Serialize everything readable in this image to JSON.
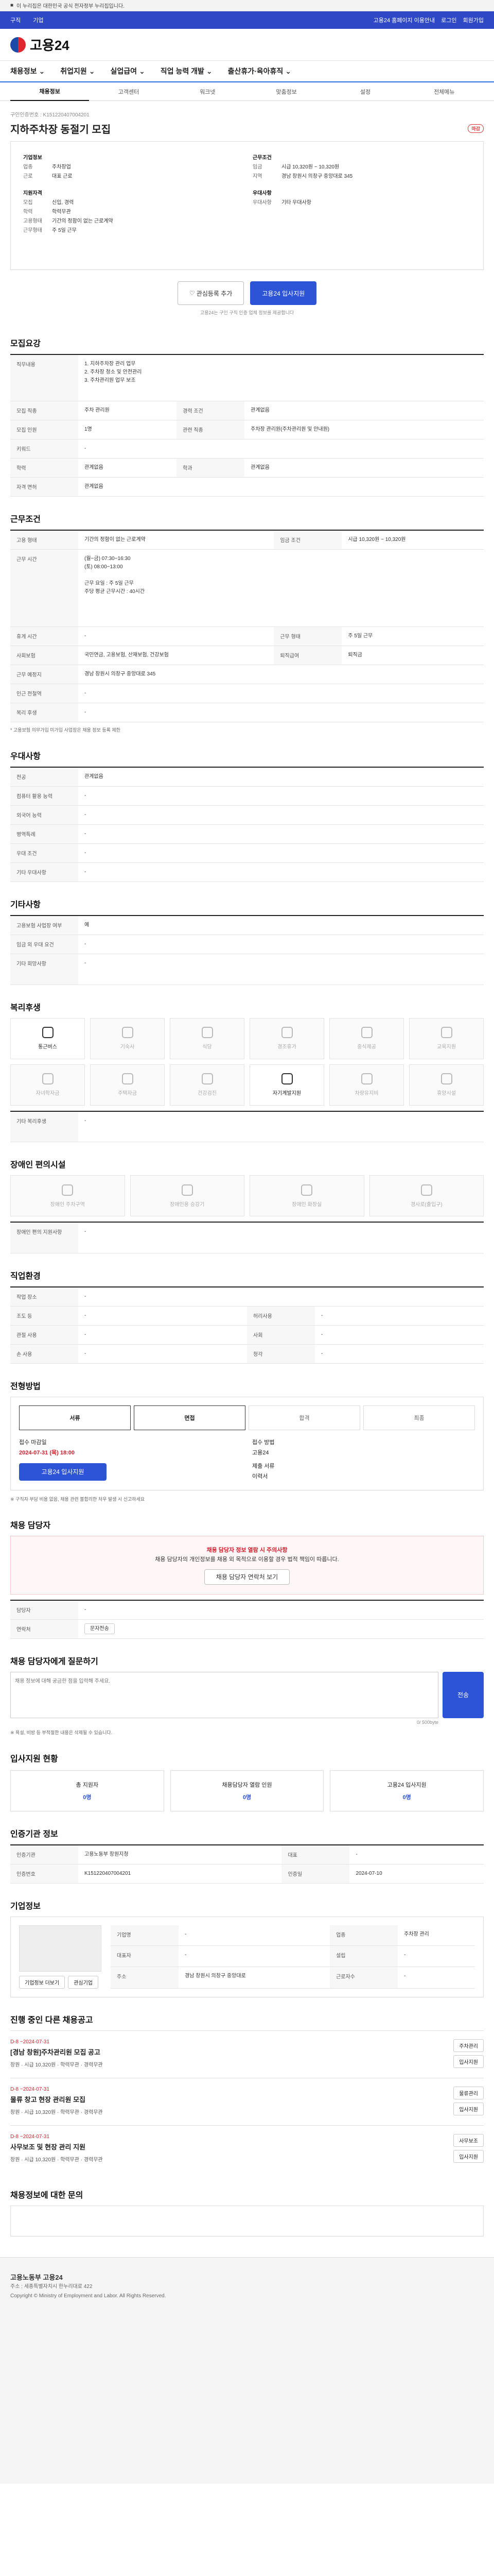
{
  "gov_banner": "이 누리집은 대한민국 공식 전자정부 누리집입니다.",
  "gnb": {
    "left": [
      "구직",
      "기업"
    ],
    "right": [
      "고용24 홈페이지 이용안내",
      "로그인",
      "회원가입"
    ]
  },
  "logo": "고용24",
  "menu": [
    "채용정보",
    "취업지원",
    "실업급여",
    "직업 능력 개발",
    "출산휴가·육아휴직"
  ],
  "tabs": [
    "채용정보",
    "고객센터",
    "워크넷",
    "맞춤정보",
    "설정",
    "전체메뉴"
  ],
  "job": {
    "number": "구인인증번호 : K151220407004201",
    "title": "지하주차장 동절기 모집",
    "status": "마감"
  },
  "summary": {
    "left": {
      "h1": "기업정보",
      "rows": [
        [
          "업종",
          "주차장업"
        ],
        [
          "근로",
          "대표 근로"
        ]
      ],
      "h2": "지원자격",
      "rows2": [
        [
          "모집",
          "신입, 경력"
        ],
        [
          "학력",
          "학력무관"
        ],
        [
          "고용형태",
          "기간의 정함이 없는 근로계약"
        ],
        [
          "근무형태",
          "주 5일 근무"
        ]
      ]
    },
    "right": {
      "h1": "근무조건",
      "rows": [
        [
          "임금",
          "시급 10,320원 ~ 10,320원"
        ],
        [
          "지역",
          "경남 창원시 의창구 중앙대로 345"
        ]
      ],
      "h2": "우대사항",
      "rows2": [
        [
          "우대사항",
          "기타 우대사항"
        ]
      ]
    }
  },
  "actions": {
    "save": "관심등록 추가",
    "apply": "고용24 입사지원",
    "notice": "고용24는 구인 구직 인증 업체 정보를 제공합니다"
  },
  "s1": {
    "title": "모집요강",
    "rows": [
      [
        "직무내용",
        "1. 지하주차장 관리 업무\n2. 주차장 청소 및 안전관리\n3. 주차관리원 업무 보조"
      ],
      [
        "모집 직종",
        "주차 관리원",
        "경력 조건",
        "관계없음"
      ],
      [
        "모집 인원",
        "1명",
        "관련 직종",
        "주차장 관리원(주차관리원 및 안내원)"
      ],
      [
        "키워드",
        "-"
      ],
      [
        "학력",
        "관계없음",
        "학과",
        "관계없음"
      ],
      [
        "자격 면허",
        "관계없음"
      ]
    ]
  },
  "s2": {
    "title": "근무조건",
    "rows": [
      [
        "고용 형태",
        "기간의 정함이 없는 근로계약",
        "임금 조건",
        "시급 10,320원 ~ 10,320원"
      ],
      [
        "근무 시간",
        "(월~금) 07:30~16:30\n(토) 08:00~13:00\n\n근무 요일 : 주 5일 근무\n주당 평균 근무시간 : 40시간",
        "",
        ""
      ],
      [
        "휴게 시간",
        "-",
        "근무 형태",
        "주 5일 근무"
      ],
      [
        "사회보험",
        "국민연금, 고용보험, 산재보험, 건강보험",
        "퇴직급여",
        "퇴직금"
      ],
      [
        "근무 예정지",
        "경남 창원시 의창구 중앙대로 345",
        "",
        ""
      ],
      [
        "인근 전철역",
        "-",
        "",
        ""
      ],
      [
        "복리 후생",
        "-",
        "",
        ""
      ]
    ],
    "note": "* 고용보험 의무가입 미가입 사업장은 채용 정보 등록 제한"
  },
  "s3": {
    "title": "우대사항",
    "rows": [
      [
        "전공",
        "관계없음"
      ],
      [
        "컴퓨터 활용 능력",
        "-"
      ],
      [
        "외국어 능력",
        "-"
      ],
      [
        "병역특례",
        "-"
      ],
      [
        "우대 조건",
        "-"
      ],
      [
        "기타 우대사항",
        "-"
      ]
    ]
  },
  "s4": {
    "title": "기타사항",
    "rows": [
      [
        "고용보험 사업장 여부",
        "예"
      ],
      [
        "임금 외 우대 요건",
        "-"
      ],
      [
        "기타 희망사항",
        "-"
      ]
    ]
  },
  "s5": {
    "title": "복리후생",
    "icons": [
      "통근버스",
      "기숙사",
      "식당",
      "경조휴가",
      "중식제공",
      "교육지원",
      "자녀학자금",
      "주택자금",
      "건강검진",
      "자기계발지원",
      "차량유지비",
      "휴양시설"
    ],
    "other": "기타 복리후생"
  },
  "s6": {
    "title": "장애인 편의시설",
    "icons": [
      "장애인 주차구역",
      "장애인용 승강기",
      "장애인 화장실",
      "경사로(출입구)"
    ],
    "other": "장애인 편의 지원사항"
  },
  "s7": {
    "title": "직업환경",
    "rows": [
      [
        "작업 장소",
        "-",
        "",
        ""
      ],
      [
        "조도 등",
        "-",
        "허리사용",
        "-"
      ],
      [
        "관절 사용",
        "-",
        "사회",
        "-"
      ],
      [
        "손 사용",
        "-",
        "청각",
        "-"
      ]
    ]
  },
  "s8": {
    "title": "전형방법",
    "steps": [
      "서류",
      "면접",
      "합격",
      "최종"
    ],
    "deadline_label": "접수 마감일",
    "deadline": "2024-07-31 (목) 18:00",
    "apply_method_label": "접수 방법",
    "apply_method": "고용24",
    "docs_label": "제출 서류",
    "docs": "이력서",
    "apply_btn": "고용24 입사지원",
    "note": "※ 구직자 부담 비용 없음, 채용 관련 불합리한 처우 발생 시 신고하세요"
  },
  "s9": {
    "title": "채용 담당자",
    "warn_title": "채용 담당자 정보 열람 시 주의사항",
    "warn_body": "채용 담당자의 개인정보를 채용 외 목적으로 이용할 경우 법적 책임이 따릅니다.",
    "warn_btn": "채용 담당자 연락처 보기",
    "label1": "담당자",
    "label2": "연락처",
    "btn2": "문자전송"
  },
  "s10": {
    "title": "채용 담당자에게 질문하기",
    "placeholder": "채용 정보에 대해 궁금한 점을 입력해 주세요.",
    "count": "0/ 500byte",
    "send": "전송",
    "note": "※ 욕설, 비방 등 부적절한 내용은 삭제될 수 있습니다."
  },
  "s11": {
    "title": "입사지원 현황",
    "boxes": [
      [
        "총 지원자",
        "0명"
      ],
      [
        "채용담당자 열람 인원",
        "0명"
      ],
      [
        "고용24 입사지원",
        "0명"
      ]
    ]
  },
  "s12": {
    "title": "인증기관 정보",
    "rows": [
      [
        "인증기관",
        "고용노동부 창원지청",
        "대표",
        "-"
      ],
      [
        "인증번호",
        "K151220407004201",
        "인증일",
        "2024-07-10"
      ]
    ]
  },
  "s13": {
    "title": "기업정보",
    "rows": [
      [
        "기업명",
        "-",
        "업종",
        "주차장 관리"
      ],
      [
        "대표자",
        "-",
        "설립",
        "-"
      ],
      [
        "주소",
        "경남 창원시 의창구 중앙대로",
        "근로자수",
        "-"
      ]
    ],
    "btn1": "기업정보 더보기",
    "btn2": "관심기업"
  },
  "s14": {
    "title": "진행 중인 다른 채용공고",
    "jobs": [
      {
        "d": "D-8 ~2024-07-31",
        "t": "[경남 창원]주차관리원 모집 공고",
        "m": "창원 · 시급 10,320원 · 학력무관 · 경력무관",
        "r": [
          "주차관리",
          "입사지원"
        ]
      },
      {
        "d": "D-8 ~2024-07-31",
        "t": "물류 창고 현장 관리원 모집",
        "m": "창원 · 시급 10,320원 · 학력무관 · 경력무관",
        "r": [
          "물류관리",
          "입사지원"
        ]
      },
      {
        "d": "D-8 ~2024-07-31",
        "t": "사무보조 및 현장 관리 지원",
        "m": "창원 · 시급 10,320원 · 학력무관 · 경력무관",
        "r": [
          "사무보조",
          "입사지원"
        ]
      }
    ]
  },
  "s15": {
    "title": "채용정보에 대한 문의"
  },
  "footer": [
    "고용노동부 고용24",
    "주소 : 세종특별자치시 한누리대로 422",
    "Copyright © Ministry of Employment and Labor. All Rights Reserved."
  ]
}
